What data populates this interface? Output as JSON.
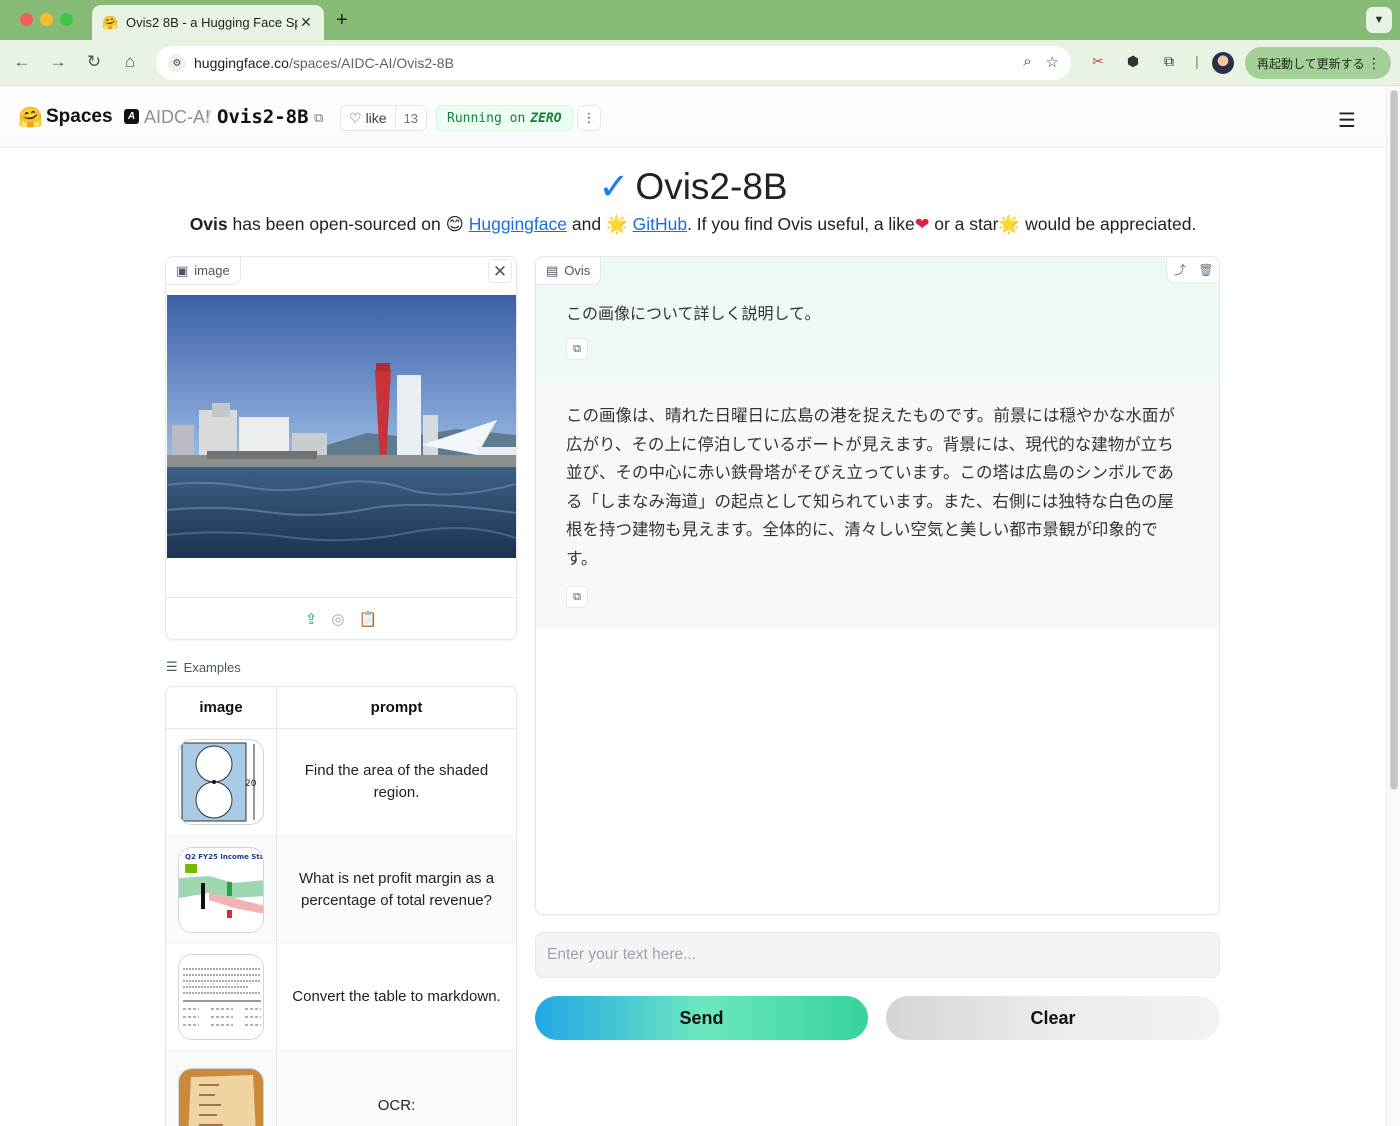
{
  "browser": {
    "tab_title": "Ovis2 8B - a Hugging Face Space",
    "url_host": "huggingface.co",
    "url_path": "/spaces/AIDC-AI/Ovis2-8B",
    "update_button": "再起動して更新する"
  },
  "header": {
    "spaces_label": "Spaces",
    "org": "AIDC-AI",
    "repo": "Ovis2-8B",
    "like_label": "like",
    "like_count": "13",
    "running_label": "Running on",
    "running_hw": "ZERO"
  },
  "page": {
    "title": "Ovis2-8B",
    "subtitle_bold": "Ovis",
    "subtitle_1": " has been open-sourced on ",
    "hf_link": "Huggingface",
    "subtitle_2": " and ",
    "gh_link": "GitHub",
    "subtitle_3": ". If you find Ovis useful, a like",
    "subtitle_4": " or a star",
    "subtitle_5": " would be appreciated."
  },
  "image_panel": {
    "label": "image"
  },
  "examples": {
    "label": "Examples",
    "headers": [
      "image",
      "prompt"
    ],
    "rows": [
      {
        "prompt": "Find the area of the shaded region."
      },
      {
        "prompt": "What is net profit margin as a percentage of total revenue?"
      },
      {
        "prompt": "Convert the table to markdown."
      },
      {
        "prompt": "OCR:"
      }
    ],
    "thumb2_caption": "Q2 FY25 Income Stat",
    "thumb1_dim": "20"
  },
  "chat": {
    "label": "Ovis",
    "user_message": "この画像について詳しく説明して。",
    "bot_message": "この画像は、晴れた日曜日に広島の港を捉えたものです。前景には穏やかな水面が広がり、その上に停泊しているボートが見えます。背景には、現代的な建物が立ち並び、その中心に赤い鉄骨塔がそびえ立っています。この塔は広島のシンボルである「しまなみ海道」の起点として知られています。また、右側には独特な白色の屋根を持つ建物も見えます。全体的に、清々しい空気と美しい都市景観が印象的です。"
  },
  "input": {
    "placeholder": "Enter your text here..."
  },
  "buttons": {
    "send": "Send",
    "clear": "Clear"
  }
}
